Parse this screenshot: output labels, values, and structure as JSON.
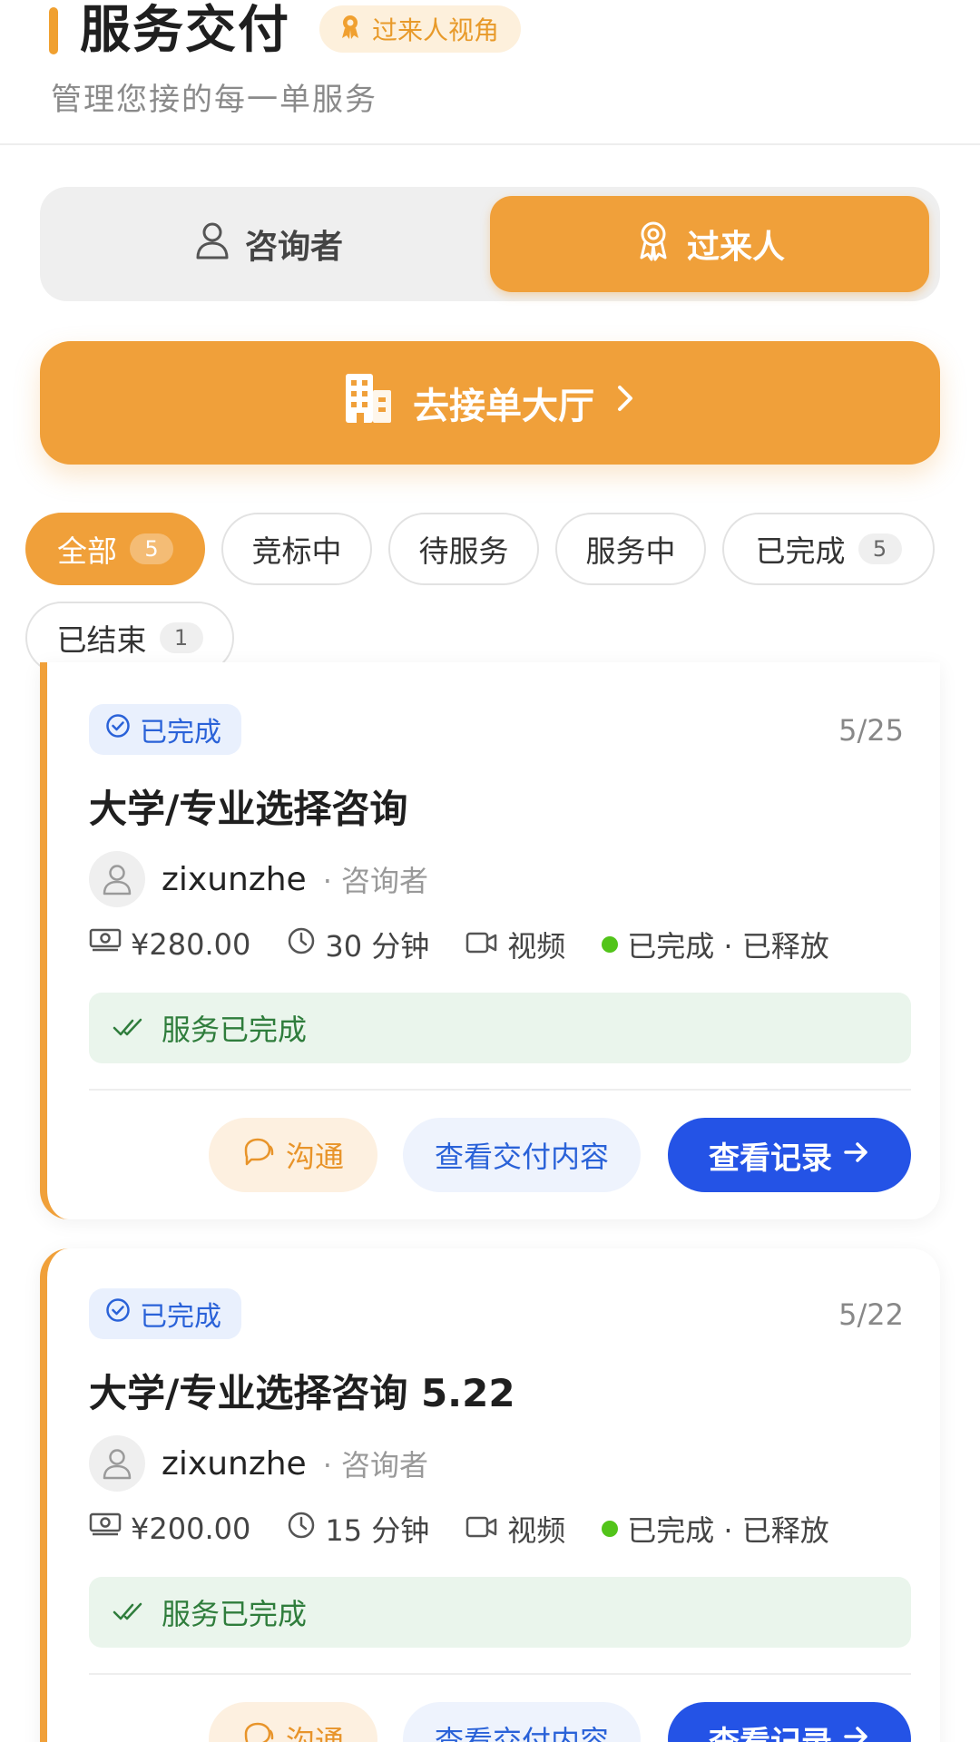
{
  "header": {
    "title": "服务交付",
    "perspective_badge": "过来人视角",
    "subtitle": "管理您接的每一单服务"
  },
  "role_toggle": {
    "seeker_label": "咨询者",
    "expert_label": "过来人",
    "selected": "过来人"
  },
  "hall_button": {
    "label": "去接单大厅"
  },
  "filters": [
    {
      "label": "全部",
      "count": "5",
      "active": true
    },
    {
      "label": "竞标中",
      "count": null,
      "active": false
    },
    {
      "label": "待服务",
      "count": null,
      "active": false
    },
    {
      "label": "服务中",
      "count": null,
      "active": false
    },
    {
      "label": "已完成",
      "count": "5",
      "active": false
    },
    {
      "label": "已结束",
      "count": "1",
      "active": false
    }
  ],
  "orders": [
    {
      "status": "已完成",
      "date": "5/25",
      "title": "大学/专业选择咨询",
      "user": "zixunzhe",
      "user_role": "· 咨询者",
      "price": "¥280.00",
      "duration": "30 分钟",
      "mode": "视频",
      "settlement": "已完成 · 已释放",
      "banner": "服务已完成",
      "actions": {
        "chat": "沟通",
        "view": "查看交付内容",
        "record": "查看记录"
      }
    },
    {
      "status": "已完成",
      "date": "5/22",
      "title": "大学/专业选择咨询 5.22",
      "user": "zixunzhe",
      "user_role": "· 咨询者",
      "price": "¥200.00",
      "duration": "15 分钟",
      "mode": "视频",
      "settlement": "已完成 · 已释放",
      "banner": "服务已完成",
      "actions": {
        "chat": "沟通",
        "view": "查看交付内容",
        "record": "查看记录"
      }
    }
  ],
  "colors": {
    "accent": "#f0a03a",
    "primary_blue": "#2453e6",
    "success_green": "#52c41a"
  }
}
